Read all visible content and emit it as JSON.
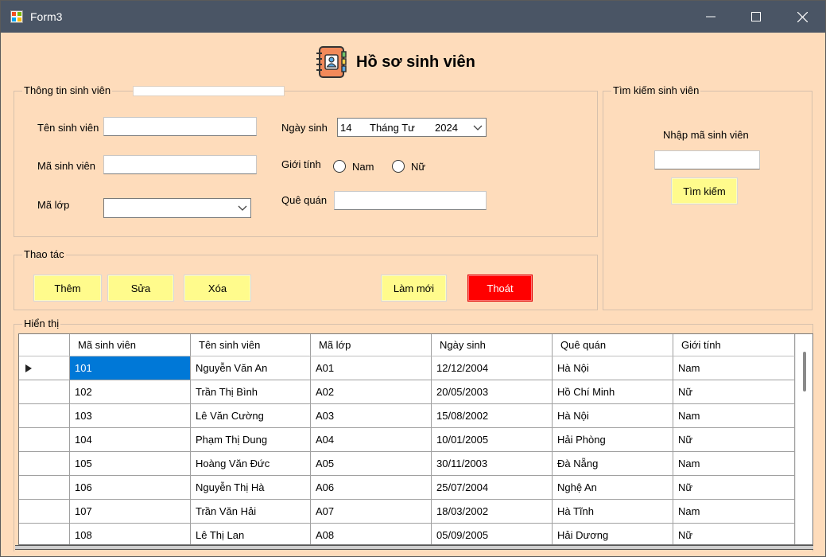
{
  "window": {
    "title": "Form3",
    "icon": "winforms-app-icon"
  },
  "header": {
    "title": "Hồ sơ sinh viên",
    "icon": "address-book-icon"
  },
  "info_group": {
    "label": "Thông tin sinh viên",
    "ten_label": "Tên sinh viên",
    "ten_value": "",
    "ma_label": "Mã sinh viên",
    "ma_value": "",
    "malop_label": "Mã lớp",
    "malop_value": "",
    "ngaysinh_label": "Ngày sinh",
    "ngaysinh_day": "14",
    "ngaysinh_month": "Tháng Tư",
    "ngaysinh_year": "2024",
    "gioitinh_label": "Giới tính",
    "gender_options": [
      "Nam",
      "Nữ"
    ],
    "quequan_label": "Quê quán",
    "quequan_value": ""
  },
  "search_group": {
    "label": "Tìm kiếm sinh viên",
    "prompt": "Nhập mã sinh viên",
    "input_value": "",
    "button": "Tìm kiếm"
  },
  "actions_group": {
    "label": "Thao tác",
    "add": "Thêm",
    "edit": "Sửa",
    "delete": "Xóa",
    "refresh": "Làm mới",
    "exit": "Thoát"
  },
  "grid": {
    "label": "Hiển thị",
    "columns": [
      "Mã sinh viên",
      "Tên sinh viên",
      "Mã lớp",
      "Ngày sinh",
      "Quê quán",
      "Giới tính"
    ],
    "rows": [
      [
        "101",
        "Nguyễn Văn An",
        "A01",
        "12/12/2004",
        "Hà Nội",
        "Nam"
      ],
      [
        "102",
        "Trần Thị Bình",
        "A02",
        "20/05/2003",
        "Hồ Chí Minh",
        "Nữ"
      ],
      [
        "103",
        "Lê Văn Cường",
        "A03",
        "15/08/2002",
        "Hà Nội",
        "Nam"
      ],
      [
        "104",
        "Phạm Thị Dung",
        "A04",
        "10/01/2005",
        "Hải Phòng",
        "Nữ"
      ],
      [
        "105",
        "Hoàng Văn Đức",
        "A05",
        "30/11/2003",
        "Đà Nẵng",
        "Nam"
      ],
      [
        "106",
        "Nguyễn Thị Hà",
        "A06",
        "25/07/2004",
        "Nghệ An",
        "Nữ"
      ],
      [
        "107",
        "Trần Văn Hải",
        "A07",
        "18/03/2002",
        "Hà Tĩnh",
        "Nam"
      ],
      [
        "108",
        "Lê Thị Lan",
        "A08",
        "05/09/2005",
        "Hải Dương",
        "Nữ"
      ]
    ],
    "selected_row": 0
  },
  "colors": {
    "form_bg": "#fedcbb",
    "titlebar": "#4a5565",
    "button_yellow": "#fffb8c",
    "button_red": "#ff0000",
    "selection": "#0078d7"
  }
}
